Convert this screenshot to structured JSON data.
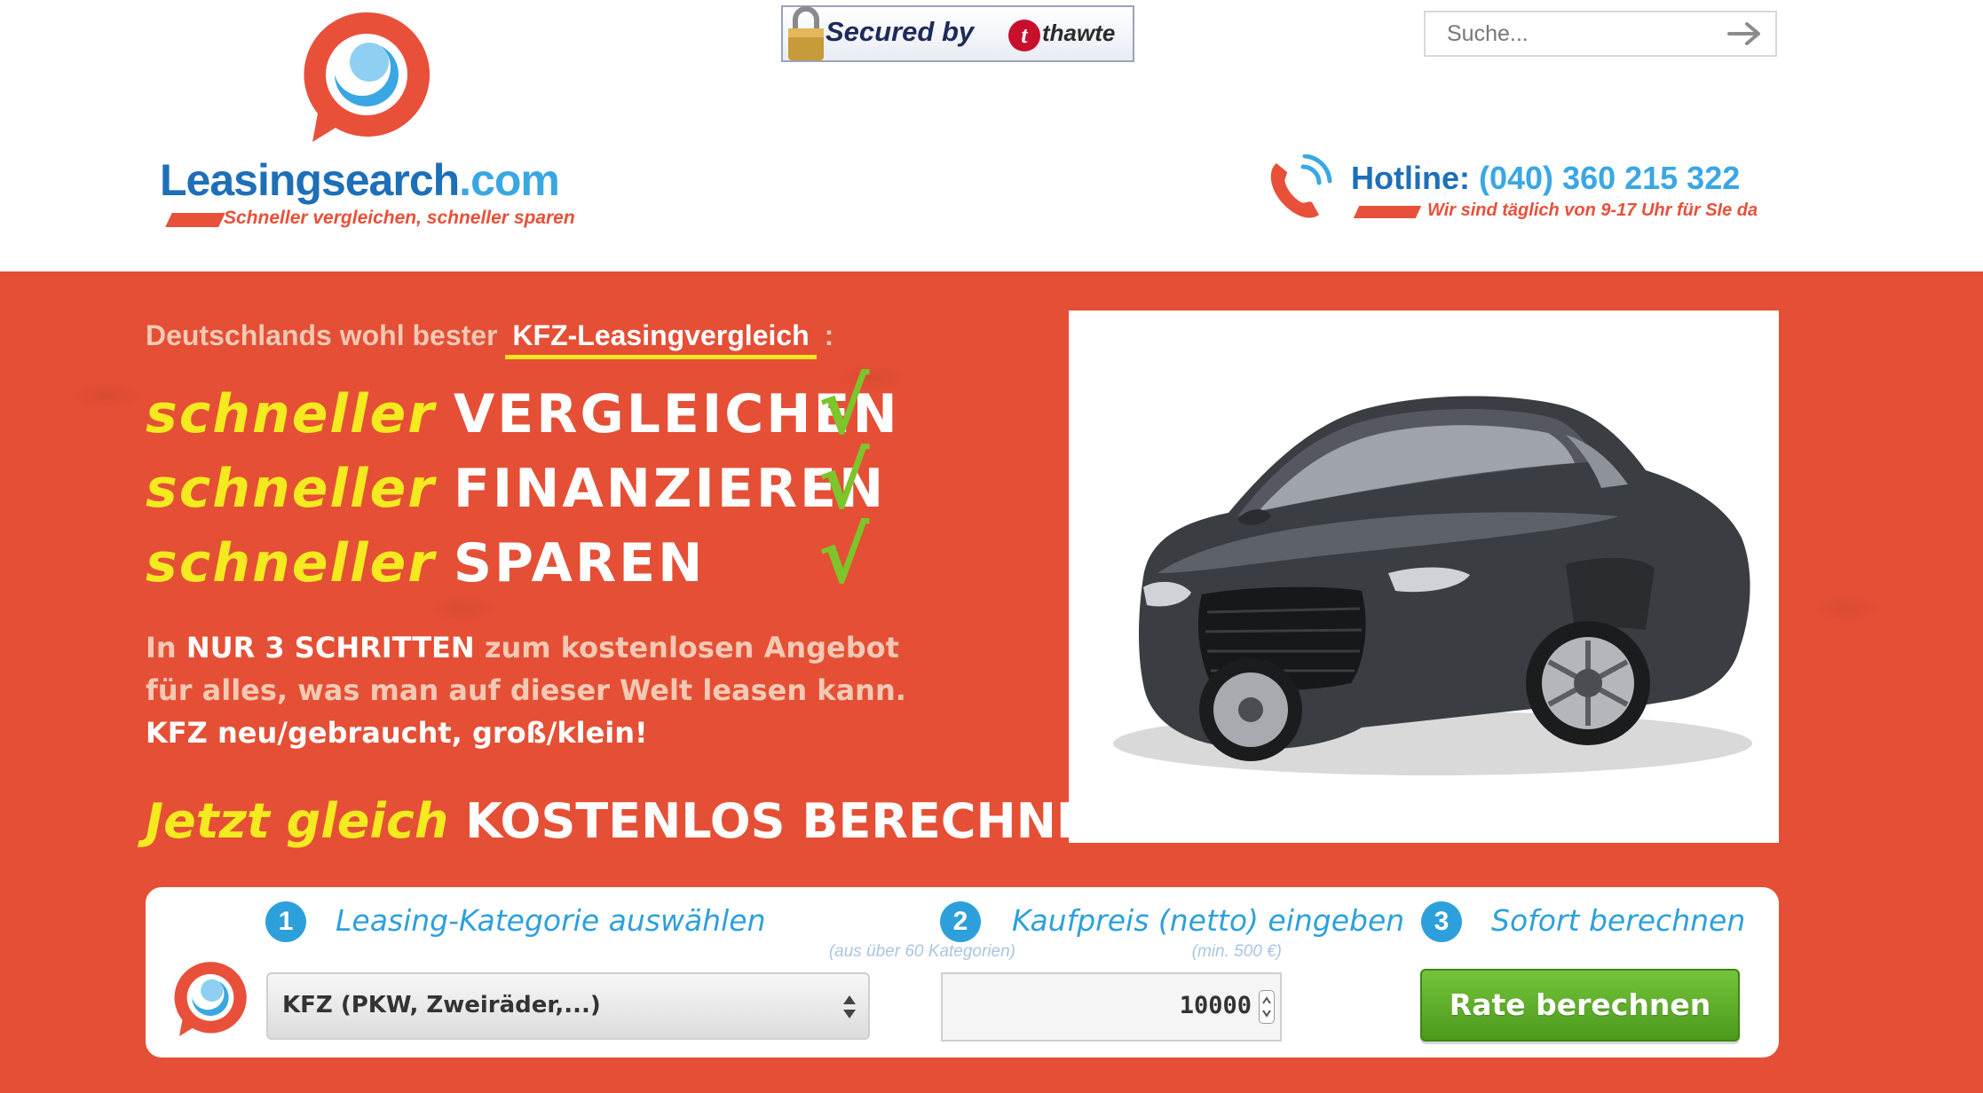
{
  "brand": {
    "name_part1": "Leasingsearch",
    "name_part2": ".com",
    "tagline": "Schneller vergleichen, schneller sparen"
  },
  "security": {
    "secured_label": "Secured by",
    "provider": "thawte",
    "provider_mark": "t"
  },
  "search": {
    "placeholder": "Suche..."
  },
  "hotline": {
    "label": "Hotline:",
    "number": "(040) 360 215 322",
    "subtext": "Wir sind täglich von 9-17 Uhr für SIe da"
  },
  "hero": {
    "intro_prefix": "Deutschlands wohl bester",
    "intro_highlight": "KFZ-Leasingvergleich",
    "intro_suffix": ":",
    "slogans": [
      {
        "prefix": "schneller",
        "word": "VERGLEICHEN"
      },
      {
        "prefix": "schneller",
        "word": "FINANZIEREN"
      },
      {
        "prefix": "schneller",
        "word": "SPAREN"
      }
    ],
    "check_glyph": "√",
    "desc": {
      "l1_a": "In",
      "l1_b": "NUR 3 SCHRITTEN",
      "l1_c": "zum kostenlosen Angebot",
      "l2": "für alles, was man auf dieser Welt leasen kann.",
      "l3": "KFZ neu/gebraucht, groß/klein!"
    },
    "cta_prefix": "Jetzt gleich",
    "cta_main": "KOSTENLOS BERECHNEN:"
  },
  "steps": [
    {
      "number": "1",
      "title": "Leasing-Kategorie auswählen",
      "hint": "(aus über 60 Kategorien)"
    },
    {
      "number": "2",
      "title": "Kaufpreis (netto) eingeben",
      "hint": "(min. 500 €)"
    },
    {
      "number": "3",
      "title": "Sofort berechnen"
    }
  ],
  "form": {
    "category_selected": "KFZ (PKW, Zweiräder,...)",
    "price_value": "10000",
    "submit_label": "Rate berechnen"
  },
  "colors": {
    "hero_bg": "#e54f35",
    "brand_blue": "#1d6fb8",
    "accent_blue": "#2da0dc",
    "yellow": "#f4ea1f",
    "green": "#7cc52a"
  }
}
